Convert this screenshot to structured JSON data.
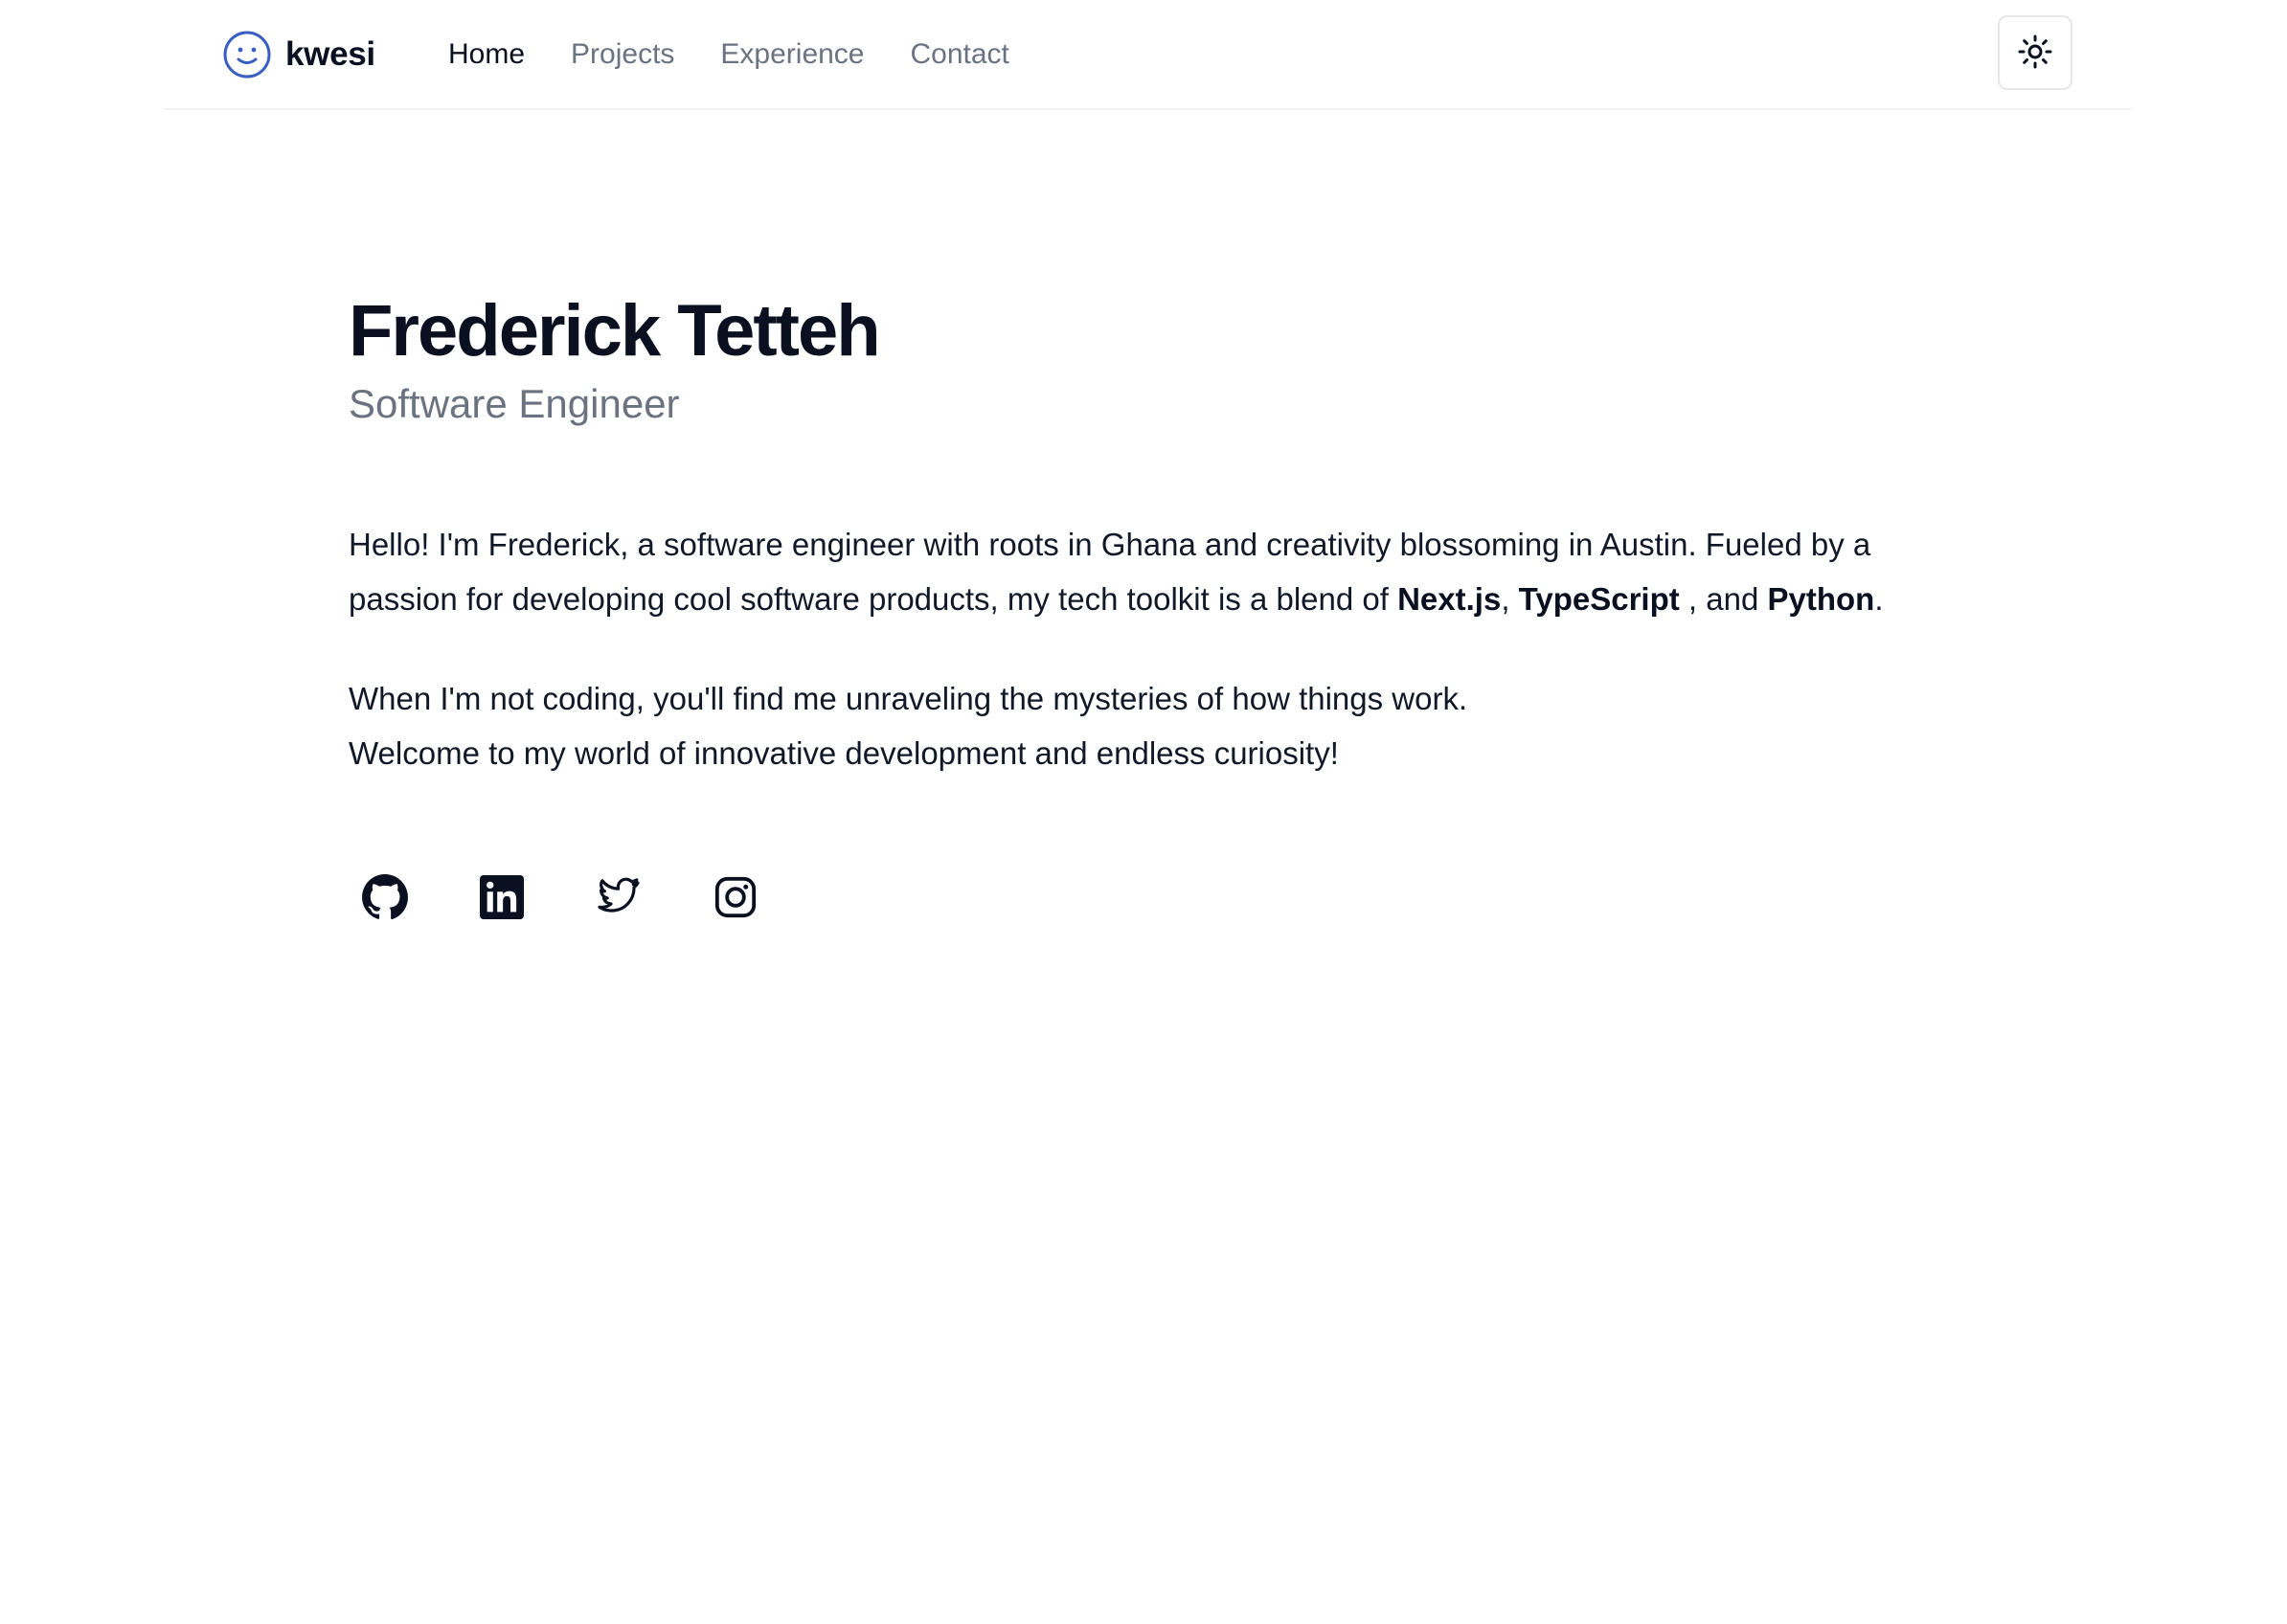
{
  "header": {
    "brand": "kwesi",
    "nav": [
      {
        "label": "Home",
        "active": true
      },
      {
        "label": "Projects",
        "active": false
      },
      {
        "label": "Experience",
        "active": false
      },
      {
        "label": "Contact",
        "active": false
      }
    ],
    "brand_icon": "smiley-face-icon",
    "theme_toggle_icon": "sun-icon"
  },
  "hero": {
    "name": "Frederick Tetteh",
    "role": "Software Engineer",
    "intro_1_a": "Hello! I'm Frederick, a software engineer with roots in Ghana and creativity blossoming in Austin. Fueled by a passion for developing cool software products, my tech toolkit is a blend of ",
    "tech_1": "Next.js",
    "sep_1": ", ",
    "tech_2": "TypeScript",
    "sep_2": " , and ",
    "tech_3": "Python",
    "end": ".",
    "intro_2": "When I'm not coding, you'll find me unraveling the mysteries of how things work. Welcome to my world of innovative development and endless curiosity!"
  },
  "socials": [
    {
      "name": "github-icon"
    },
    {
      "name": "linkedin-icon"
    },
    {
      "name": "twitter-icon"
    },
    {
      "name": "instagram-icon"
    }
  ],
  "colors": {
    "text": "#0b1020",
    "muted": "#6b7280",
    "brand_icon": "#3b5fc0",
    "border": "#e5e7eb"
  }
}
